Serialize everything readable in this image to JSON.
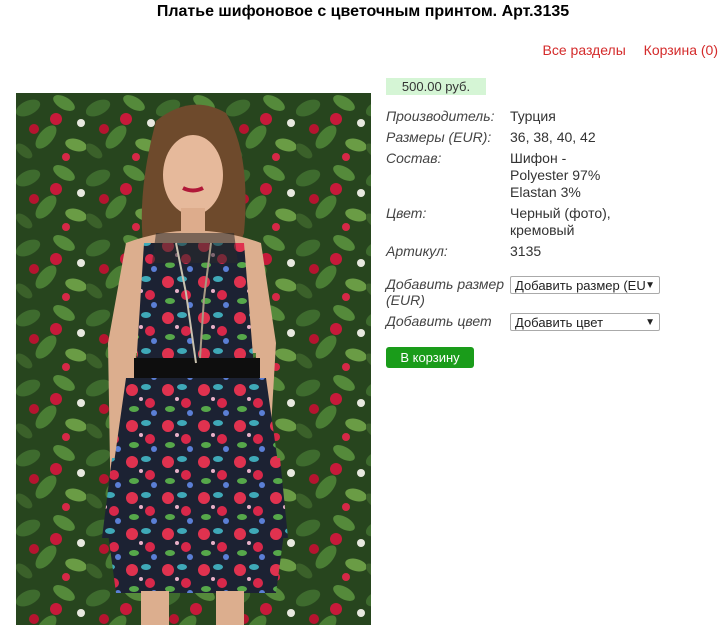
{
  "product": {
    "title": "Платье шифоновое с цветочным принтом. Арт.3135",
    "price": "500.00 руб.",
    "specs": [
      {
        "label": "Производитель:",
        "value": "Турция"
      },
      {
        "label": "Размеры (EUR):",
        "value": "36, 38, 40, 42"
      },
      {
        "label": "Состав:",
        "value": "Шифон - Polyester 97% Elastan 3%"
      },
      {
        "label": "Цвет:",
        "value": "Черный (фото), кремовый"
      },
      {
        "label": "Артикул:",
        "value": "3135"
      }
    ],
    "add_size_label": "Добавить размер (EUR)",
    "add_size_select": "Добавить размер (EUR)",
    "add_color_label": "Добавить цвет",
    "add_color_select": "Добавить цвет",
    "cart_button": "В корзину"
  },
  "nav": {
    "all_sections": "Все разделы",
    "cart": "Корзина (0)"
  },
  "icons": {
    "dropdown": "chevron-down-icon"
  }
}
